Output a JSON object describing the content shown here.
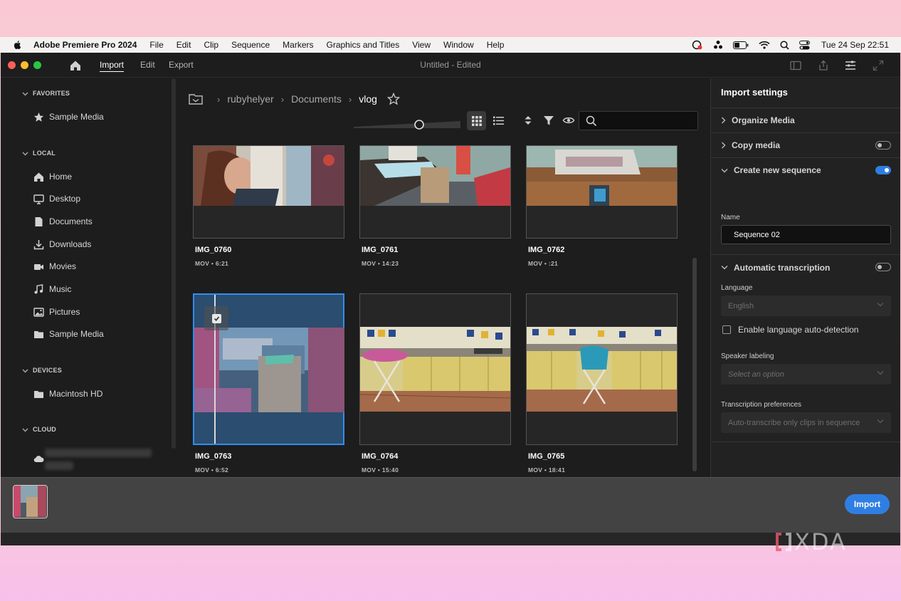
{
  "menubar": {
    "app_name": "Adobe Premiere Pro 2024",
    "items": [
      "File",
      "Edit",
      "Clip",
      "Sequence",
      "Markers",
      "Graphics and Titles",
      "View",
      "Window",
      "Help"
    ],
    "clock": "Tue 24 Sep  22:51"
  },
  "titlebar": {
    "tabs": [
      "Import",
      "Edit",
      "Export"
    ],
    "active_tab": "Import",
    "document_title": "Untitled - Edited"
  },
  "sidebar": {
    "favorites_label": "FAVORITES",
    "favorites": [
      {
        "label": "Sample Media",
        "icon": "star-icon"
      }
    ],
    "local_label": "LOCAL",
    "local": [
      {
        "label": "Home",
        "icon": "home-icon"
      },
      {
        "label": "Desktop",
        "icon": "desktop-icon"
      },
      {
        "label": "Documents",
        "icon": "document-icon"
      },
      {
        "label": "Downloads",
        "icon": "download-icon"
      },
      {
        "label": "Movies",
        "icon": "video-camera-icon"
      },
      {
        "label": "Music",
        "icon": "music-note-icon"
      },
      {
        "label": "Pictures",
        "icon": "picture-icon"
      },
      {
        "label": "Sample Media",
        "icon": "folder-icon"
      }
    ],
    "devices_label": "DEVICES",
    "devices": [
      {
        "label": "Macintosh HD",
        "icon": "folder-icon"
      }
    ],
    "cloud_label": "CLOUD"
  },
  "breadcrumb": {
    "parts": [
      "rubyhelyer",
      "Documents",
      "vlog"
    ]
  },
  "search": {
    "value": "",
    "placeholder": ""
  },
  "clips": [
    {
      "name": "IMG_0760",
      "meta": "MOV • 6:21",
      "selected": false
    },
    {
      "name": "IMG_0761",
      "meta": "MOV • 14:23",
      "selected": false
    },
    {
      "name": "IMG_0762",
      "meta": "MOV • :21",
      "selected": false
    },
    {
      "name": "IMG_0763",
      "meta": "MOV • 6:52",
      "selected": true
    },
    {
      "name": "IMG_0764",
      "meta": "MOV • 15:40",
      "selected": false
    },
    {
      "name": "IMG_0765",
      "meta": "MOV • 18:41",
      "selected": false
    }
  ],
  "import_settings": {
    "title": "Import settings",
    "organize_media": "Organize Media",
    "copy_media": "Copy media",
    "copy_media_on": false,
    "create_sequence": "Create new sequence",
    "create_sequence_on": true,
    "name_label": "Name",
    "name_value": "Sequence 02",
    "auto_transcription": "Automatic transcription",
    "auto_transcription_on": false,
    "language_label": "Language",
    "language_value": "English",
    "auto_detect_label": "Enable language auto-detection",
    "speaker_label": "Speaker labeling",
    "speaker_placeholder": "Select an option",
    "transcription_pref_label": "Transcription preferences",
    "transcription_pref_value": "Auto-transcribe only clips in sequence"
  },
  "tray": {
    "import_button": "Import"
  },
  "colors": {
    "accent": "#2f7fe3",
    "selection": "#2b4d6f",
    "window_bg": "#1d1d1d"
  },
  "watermark": "XDA"
}
